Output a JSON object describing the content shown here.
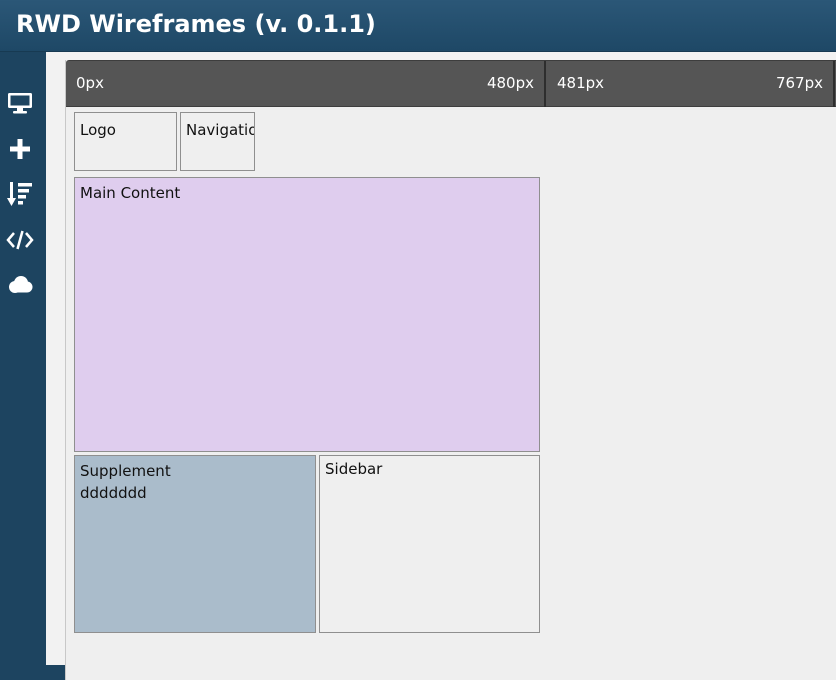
{
  "app": {
    "title": "RWD Wireframes (v. 0.1.1)"
  },
  "sidebar": {
    "items": [
      {
        "name": "desktop-icon"
      },
      {
        "name": "plus-icon"
      },
      {
        "name": "sort-icon"
      },
      {
        "name": "code-icon"
      },
      {
        "name": "cloud-icon"
      }
    ]
  },
  "ruler": {
    "segments": [
      {
        "start": "0px",
        "end": "480px"
      },
      {
        "start": "481px",
        "end": "767px"
      }
    ]
  },
  "blocks": {
    "logo": "Logo",
    "navigation": "Navigation",
    "main": "Main Content",
    "supplement": "Supplement",
    "supplement_text": "ddddddd",
    "sidebar": "Sidebar"
  },
  "colors": {
    "header": "#1e4866",
    "main_content": "#dfcdee",
    "supplement": "#aabccb",
    "ruler": "#555555"
  }
}
